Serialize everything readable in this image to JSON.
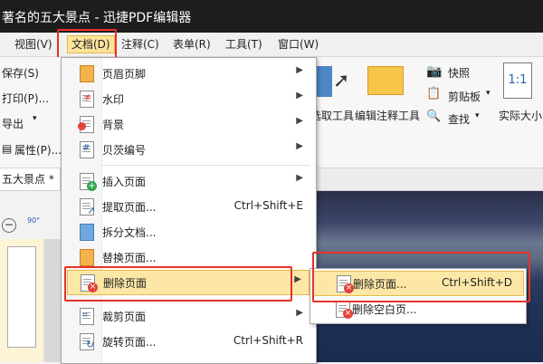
{
  "window": {
    "title": "著名的五大景点 - 迅捷PDF编辑器"
  },
  "menubar": {
    "items": [
      {
        "label": "视图(V)"
      },
      {
        "label": "文档(D)"
      },
      {
        "label": "注释(C)"
      },
      {
        "label": "表单(R)"
      },
      {
        "label": "工具(T)"
      },
      {
        "label": "窗口(W)"
      }
    ]
  },
  "ribbon": {
    "left": {
      "save": "保存(S)",
      "print": "打印(P)...",
      "export": "导出",
      "properties": "属性(P)..."
    },
    "right": {
      "select_tool": "选取工具",
      "edit_annotation_tool": "编辑注释工具",
      "snapshot": "快照",
      "clipboard": "剪贴板",
      "find": "查找",
      "actual_size": "实际大小",
      "actual_size_icon": "1:1"
    }
  },
  "tab": {
    "label": "五大景点 *"
  },
  "zoom": {
    "rotate_label": "90°"
  },
  "dropdown": {
    "items": [
      {
        "label": "页眉页脚",
        "submenu": true
      },
      {
        "label": "水印",
        "submenu": true
      },
      {
        "label": "背景",
        "submenu": true
      },
      {
        "label": "贝茨编号",
        "submenu": true
      },
      {
        "label": "插入页面",
        "submenu": true
      },
      {
        "label": "提取页面...",
        "shortcut": "Ctrl+Shift+E"
      },
      {
        "label": "拆分文档..."
      },
      {
        "label": "替换页面..."
      },
      {
        "label": "删除页面",
        "submenu": true
      },
      {
        "label": "裁剪页面",
        "submenu": true
      },
      {
        "label": "旋转页面...",
        "shortcut": "Ctrl+Shift+R"
      }
    ]
  },
  "submenu": {
    "items": [
      {
        "label": "删除页面...",
        "shortcut": "Ctrl+Shift+D"
      },
      {
        "label": "删除空白页..."
      }
    ]
  },
  "colors": {
    "highlight": "#fde7a6",
    "annotation_red": "#e8322b",
    "titlebar": "#1d1d1d"
  }
}
